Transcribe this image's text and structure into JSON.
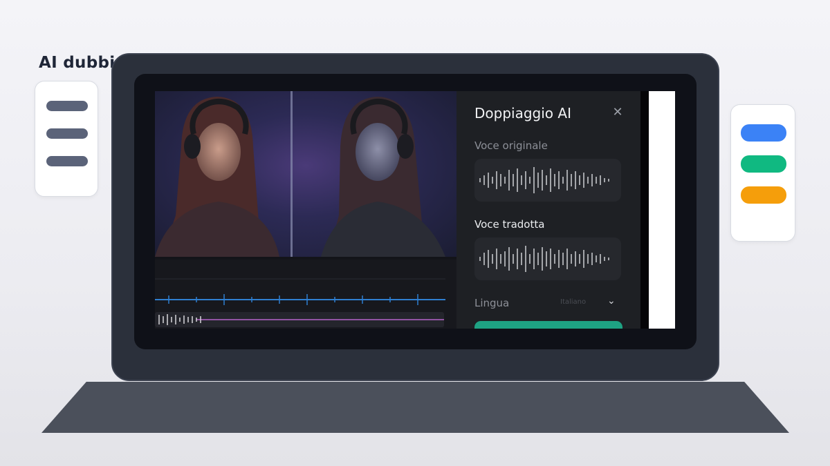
{
  "page": {
    "heading": "AI dubbing"
  },
  "left_card": {
    "bars": [
      {
        "color": "#5b6379"
      },
      {
        "color": "#5b6379"
      },
      {
        "color": "#5b6379"
      }
    ]
  },
  "right_card": {
    "bars": [
      {
        "color": "#3b82f6"
      },
      {
        "color": "#10b981"
      },
      {
        "color": "#f59e0b"
      }
    ]
  },
  "dubbing_panel": {
    "title": "Doppiaggio AI",
    "close_icon": "close-icon",
    "original_voice_label": "Voce originale",
    "translated_voice_label": "Voce tradotta",
    "language_label": "Lingua",
    "language_value": "Italiano",
    "accent_color": "#1ea283"
  },
  "colors": {
    "laptop_lid": "#2b303b",
    "laptop_base": "#4b505b",
    "bezel": "#0f1118"
  }
}
